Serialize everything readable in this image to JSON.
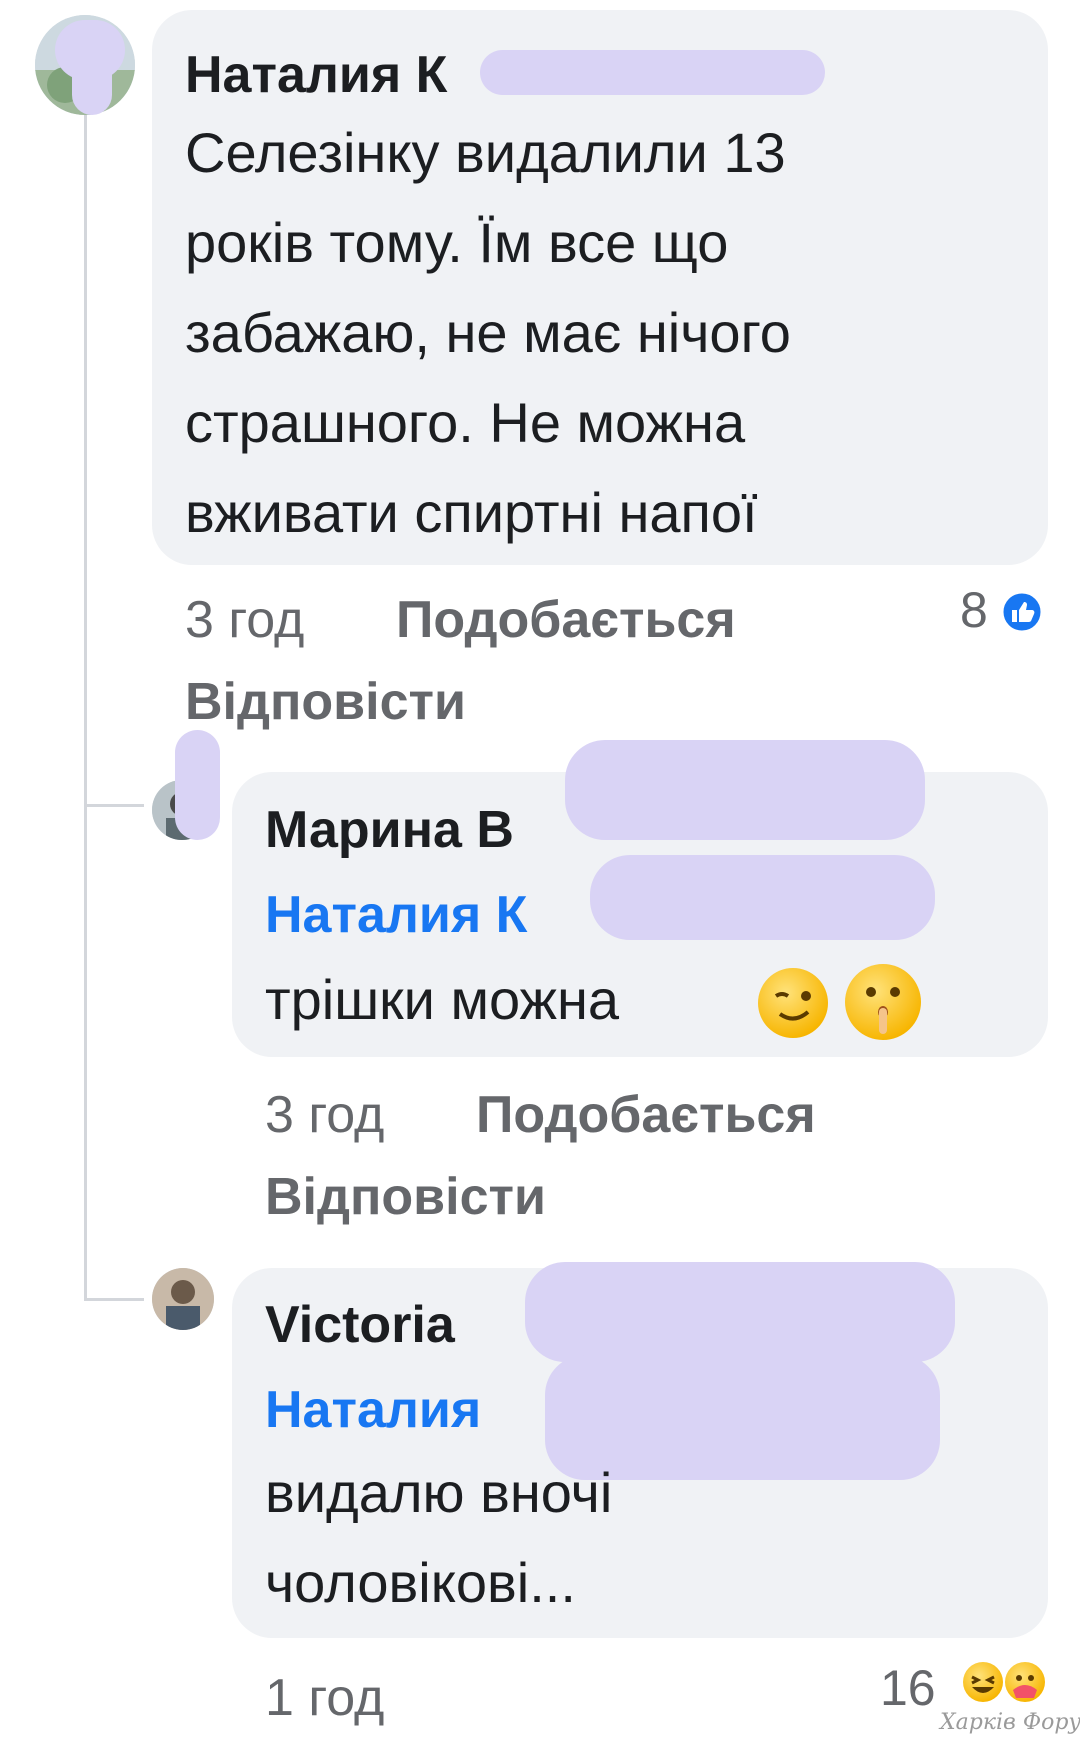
{
  "comments": [
    {
      "author": "Наталия К",
      "body_lines": [
        "Селезінку видалили 13",
        "років тому. Їм все що",
        "забажаю, не має нічого",
        "страшного. Не можна",
        "вживати спиртні напої"
      ],
      "time": "3 год",
      "like_label": "Подобається",
      "reply_label": "Відповісти",
      "reaction_count": "8"
    },
    {
      "author": "Марина В",
      "mention": "Наталия К",
      "body_lines": [
        "трішки можна"
      ],
      "time": "3 год",
      "like_label": "Подобається",
      "reply_label": "Відповісти"
    },
    {
      "author": "Victoria",
      "mention": "Наталия",
      "body_lines": [
        "видалю вночі",
        "чоловікові..."
      ],
      "time": "1 год",
      "reaction_count": "16"
    }
  ],
  "watermark": "Харків Форум",
  "colors": {
    "bubble": "#f0f2f5",
    "mention": "#1877f2",
    "meta": "#65676b",
    "like_badge": "#1877f2",
    "redaction": "#d9d3f5"
  }
}
